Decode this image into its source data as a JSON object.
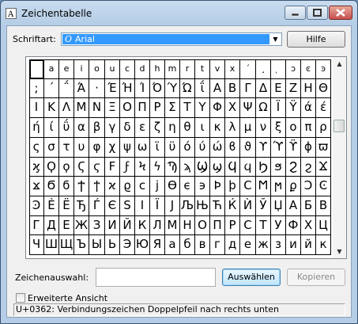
{
  "window": {
    "title": "Zeichentabelle"
  },
  "font": {
    "label": "Schriftart:",
    "value": "Arial",
    "icon_glyph": "O"
  },
  "buttons": {
    "help": "Hilfe",
    "select": "Auswählen",
    "copy": "Kopieren"
  },
  "chars_label": "Zeichenauswahl:",
  "chars_value": "",
  "advanced_view": "Erweiterte Ansicht",
  "status": "U+0362: Verbindungszeichen Doppelpfeil nach rechts unten",
  "grid": {
    "rows": [
      [
        "",
        "a",
        "e",
        "i",
        "o",
        "u",
        "c",
        "d",
        "h",
        "m",
        "r",
        "t",
        "v",
        "x",
        "´",
        "¸",
        "ͅ",
        "ͻ",
        "ͼ",
        "ͽ"
      ],
      [
        ";",
        "΄",
        "΅",
        "Ά",
        "·",
        "Έ",
        "Ή",
        "Ί",
        "Ό",
        "Ύ",
        "Ώ",
        "ΐ",
        "Α",
        "Β",
        "Γ",
        "Δ",
        "Ε",
        "Ζ",
        "Η",
        "Θ"
      ],
      [
        "Ι",
        "Κ",
        "Λ",
        "Μ",
        "Ν",
        "Ξ",
        "Ο",
        "Π",
        "Ρ",
        "Σ",
        "Τ",
        "Υ",
        "Φ",
        "Χ",
        "Ψ",
        "Ω",
        "Ϊ",
        "Ϋ",
        "ά",
        "έ"
      ],
      [
        "ή",
        "ί",
        "ΰ",
        "α",
        "β",
        "γ",
        "δ",
        "ε",
        "ζ",
        "η",
        "θ",
        "ι",
        "κ",
        "λ",
        "μ",
        "ν",
        "ξ",
        "ο",
        "π",
        "ρ"
      ],
      [
        "ς",
        "σ",
        "τ",
        "υ",
        "φ",
        "χ",
        "ψ",
        "ω",
        "ϊ",
        "ϋ",
        "ό",
        "ύ",
        "ώ",
        "ϐ",
        "ϑ",
        "ϒ",
        "ϓ",
        "ϔ",
        "ϕ",
        "ϖ"
      ],
      [
        "ϗ",
        "Ϙ",
        "ϙ",
        "Ϛ",
        "ϛ",
        "Ϝ",
        "ϝ",
        "Ϟ",
        "ϟ",
        "Ϡ",
        "ϡ",
        "Ϣ",
        "ϣ",
        "Ϥ",
        "ϥ",
        "Ϧ",
        "ϧ",
        "Ϩ",
        "ϩ",
        "Ϫ"
      ],
      [
        "ϫ",
        "Ϭ",
        "ϭ",
        "Ϯ",
        "ϯ",
        "ϰ",
        "ϱ",
        "ϲ",
        "ϳ",
        "ϴ",
        "ϵ",
        "϶",
        "Ϸ",
        "ϸ",
        "Ϲ",
        "Ϻ",
        "ϻ",
        "ϼ",
        "Ͻ",
        "Ͼ"
      ],
      [
        "Ͽ",
        "Ѐ",
        "Ё",
        "Ђ",
        "Ѓ",
        "Є",
        "Ѕ",
        "І",
        "Ї",
        "Ј",
        "Љ",
        "Њ",
        "Ћ",
        "Ќ",
        "Ѝ",
        "Ў",
        "Џ",
        "А",
        "Б",
        "В"
      ],
      [
        "Г",
        "Д",
        "Е",
        "Ж",
        "З",
        "И",
        "Й",
        "К",
        "Л",
        "М",
        "Н",
        "О",
        "П",
        "Р",
        "С",
        "Т",
        "У",
        "Ф",
        "Х",
        "Ц"
      ],
      [
        "Ч",
        "Ш",
        "Щ",
        "Ъ",
        "Ы",
        "Ь",
        "Э",
        "Ю",
        "Я",
        "а",
        "б",
        "в",
        "г",
        "д",
        "е",
        "ж",
        "з",
        "и",
        "й",
        "к"
      ]
    ],
    "selected_row": 0,
    "selected_col": 0
  },
  "colors": {
    "selection": "#3399ff",
    "window_frame": "#b5cde6"
  }
}
